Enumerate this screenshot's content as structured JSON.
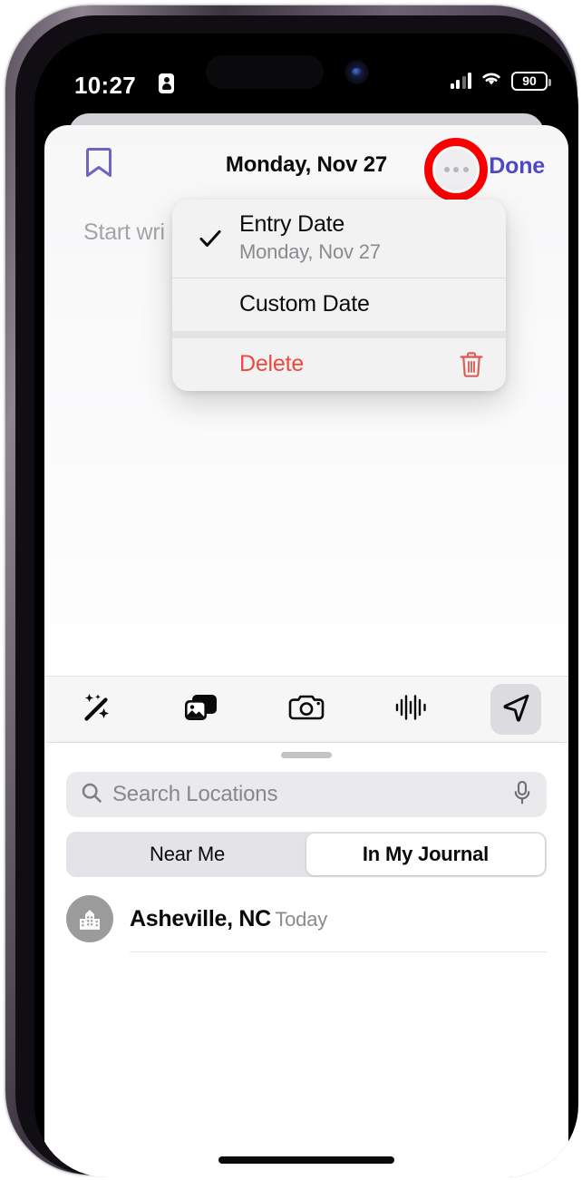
{
  "device": {
    "status_bar": {
      "time": "10:27",
      "recording_badge_icon": "id-card-icon",
      "cellular_icon": "signal-bars-icon",
      "wifi_icon": "wifi-icon",
      "battery_percent": "90"
    },
    "home_indicator_label": "home-indicator"
  },
  "nav": {
    "bookmark_icon": "bookmark-icon",
    "title": "Monday, Nov 27",
    "more_icon": "ellipsis-circle-icon",
    "done_label": "Done",
    "highlight_color": "#f90000",
    "accent_color": "#4c48c8"
  },
  "editor": {
    "placeholder": "Start wri"
  },
  "context_menu": {
    "items": [
      {
        "label": "Entry Date",
        "subtitle": "Monday, Nov 27",
        "checked": true,
        "destructive": false,
        "trailing_icon": ""
      },
      {
        "label": "Custom Date",
        "subtitle": "",
        "checked": false,
        "destructive": false,
        "trailing_icon": ""
      },
      {
        "label": "Delete",
        "subtitle": "",
        "checked": false,
        "destructive": true,
        "trailing_icon": "trash-icon"
      }
    ],
    "destructive_color": "#f0483c"
  },
  "attachments_toolbar": {
    "buttons": [
      {
        "name": "magic-wand-icon",
        "label": "Suggestions",
        "selected": false
      },
      {
        "name": "photos-icon",
        "label": "Photos",
        "selected": false
      },
      {
        "name": "camera-icon",
        "label": "Camera",
        "selected": false
      },
      {
        "name": "audio-wave-icon",
        "label": "Audio",
        "selected": false
      },
      {
        "name": "location-arrow-icon",
        "label": "Location",
        "selected": true
      }
    ]
  },
  "location_sheet": {
    "grabber": "sheet-grabber",
    "search": {
      "placeholder": "Search Locations",
      "search_icon": "search-icon",
      "mic_icon": "microphone-icon"
    },
    "segments": [
      {
        "label": "Near Me",
        "active": false
      },
      {
        "label": "In My Journal",
        "active": true
      }
    ],
    "results": [
      {
        "avatar_icon": "city-buildings-icon",
        "name": "Asheville, NC",
        "subtitle": "Today"
      }
    ]
  }
}
